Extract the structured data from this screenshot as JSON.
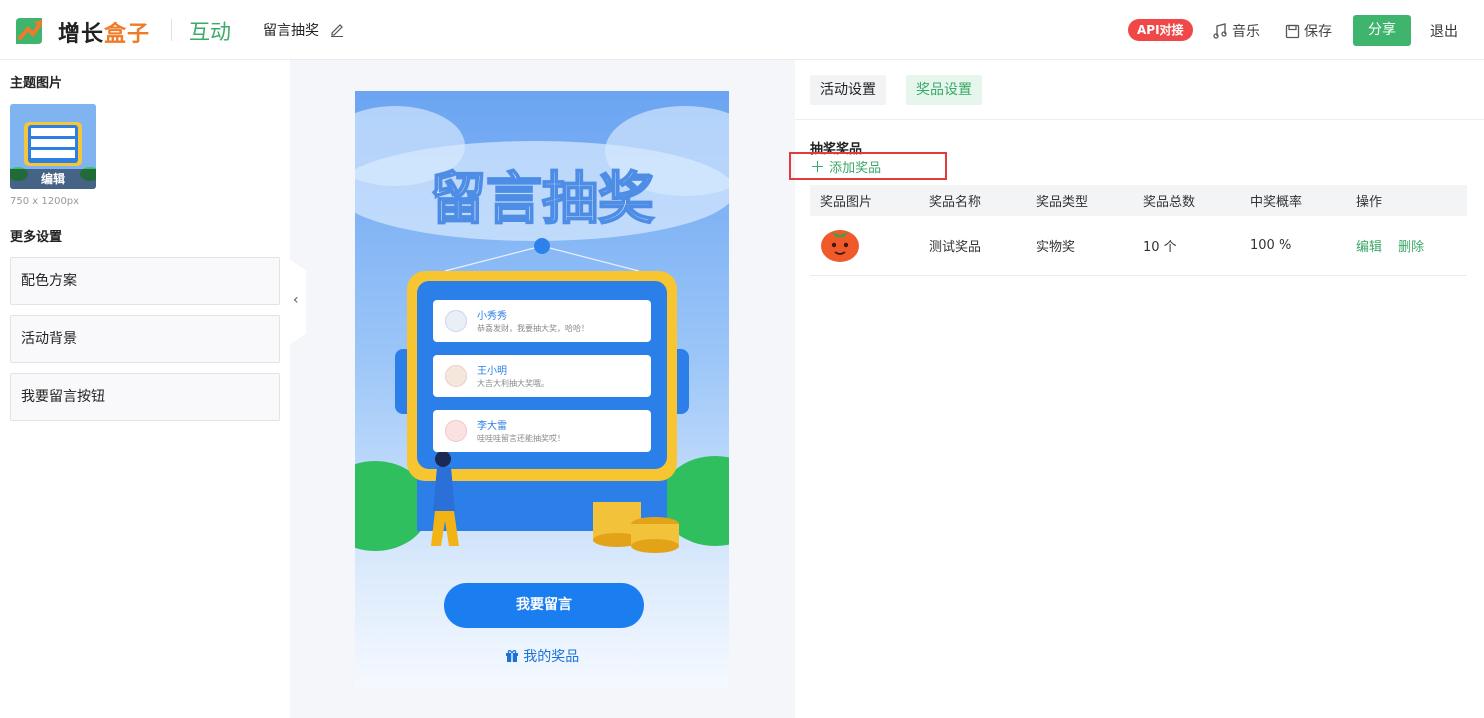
{
  "header": {
    "brand_main": "增长",
    "brand_accent": "盒子",
    "module": "互动",
    "page_name": "留言抽奖",
    "api_badge": "API对接",
    "music": "音乐",
    "save": "保存",
    "share": "分享",
    "logout": "退出"
  },
  "left": {
    "theme_title": "主题图片",
    "thumb_edit": "编辑",
    "dims": "750 x 1200px",
    "more_title": "更多设置",
    "settings": [
      "配色方案",
      "活动背景",
      "我要留言按钮"
    ]
  },
  "preview": {
    "title": "留言抽奖",
    "comments": [
      {
        "name": "小秀秀",
        "text": "恭喜发财，我要抽大奖，哈哈！"
      },
      {
        "name": "王小明",
        "text": "大吉大利抽大奖哦。"
      },
      {
        "name": "李大雷",
        "text": "哇哇哇留言还能抽奖哎！"
      }
    ],
    "leave_msg": "我要留言",
    "my_prize": "我的奖品"
  },
  "right": {
    "tabs": [
      "活动设置",
      "奖品设置"
    ],
    "section_title": "抽奖奖品",
    "add_prize": "添加奖品",
    "columns": [
      "奖品图片",
      "奖品名称",
      "奖品类型",
      "奖品总数",
      "中奖概率",
      "操作"
    ],
    "rows": [
      {
        "name": "测试奖品",
        "type": "实物奖",
        "count": "10 个",
        "prob": "100 %",
        "edit": "编辑",
        "delete": "删除"
      }
    ]
  },
  "colors": {
    "accent_green": "#3aa868",
    "brand_orange": "#f07a28",
    "api_red": "#f04848",
    "primary_blue": "#1a7ef1"
  }
}
